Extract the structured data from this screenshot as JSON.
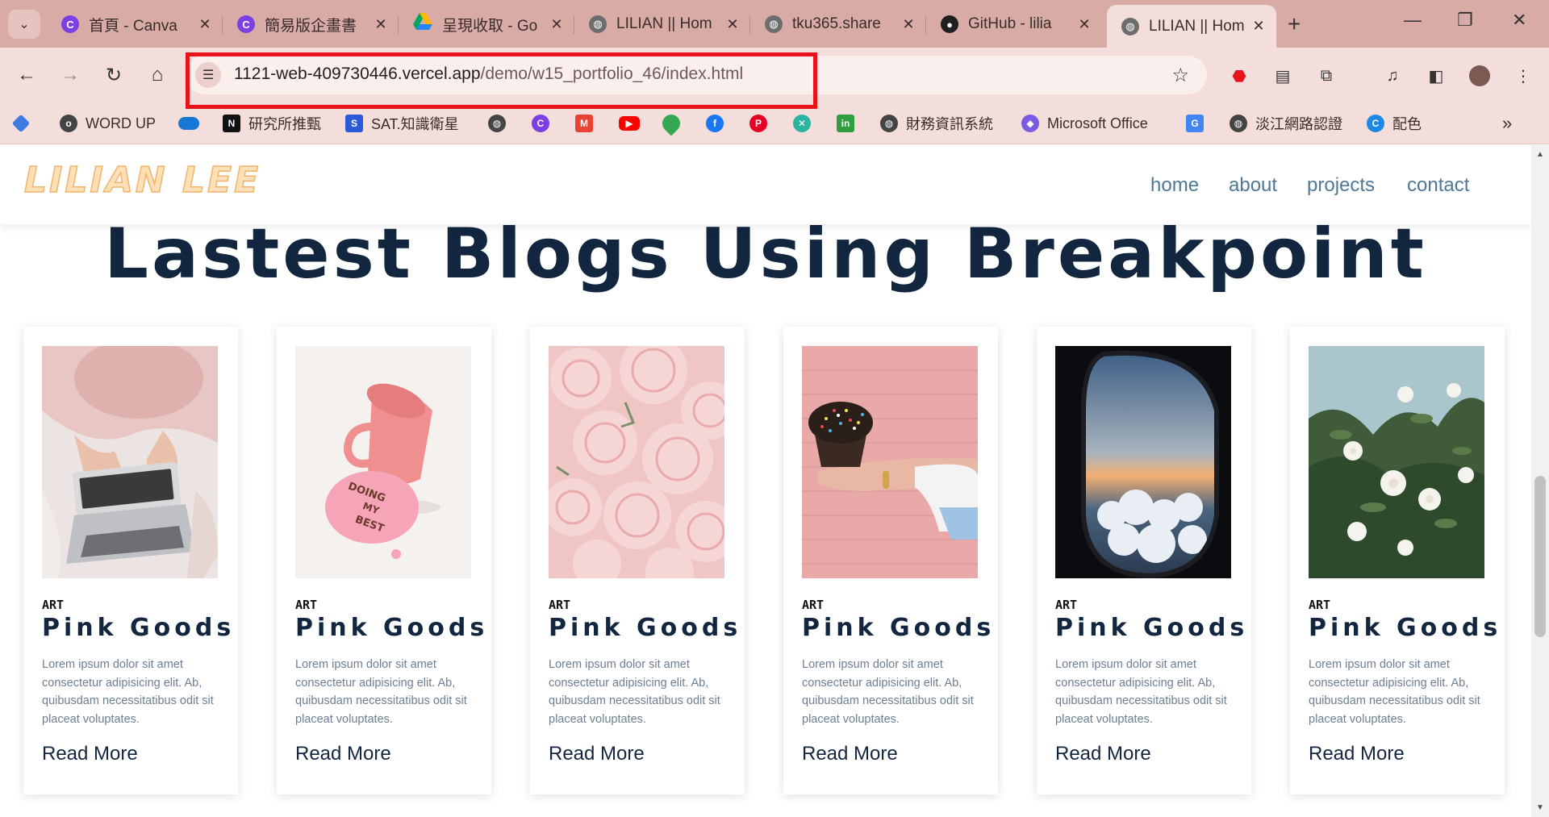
{
  "browser": {
    "tabs": [
      {
        "title": "首頁 - Canva",
        "icon": "canva-icon"
      },
      {
        "title": "簡易版企畫書",
        "icon": "canva-icon"
      },
      {
        "title": "呈現收取 - Go",
        "icon": "google-drive-icon"
      },
      {
        "title": "LILIAN || Hom",
        "icon": "globe-icon"
      },
      {
        "title": "tku365.share",
        "icon": "globe-icon"
      },
      {
        "title": "GitHub - lilia",
        "icon": "github-icon"
      },
      {
        "title": "LILIAN || Hom",
        "icon": "globe-icon",
        "active": true
      }
    ],
    "url_host": "1121-web-409730446.vercel.app",
    "url_path": "/demo/w15_portfolio_46/index.html",
    "bookmarks": [
      {
        "label": "",
        "icon": "bookmark-diamond-icon"
      },
      {
        "label": "WORD UP",
        "icon": "word-up-icon"
      },
      {
        "label": "",
        "icon": "onedrive-icon"
      },
      {
        "label": "研究所推甄",
        "icon": "notion-icon"
      },
      {
        "label": "SAT.知識衛星",
        "icon": "sat-icon"
      },
      {
        "label": "",
        "icon": "globe-icon"
      },
      {
        "label": "",
        "icon": "canva-icon"
      },
      {
        "label": "",
        "icon": "gmail-icon"
      },
      {
        "label": "",
        "icon": "youtube-icon"
      },
      {
        "label": "",
        "icon": "maps-icon"
      },
      {
        "label": "",
        "icon": "facebook-icon"
      },
      {
        "label": "",
        "icon": "pinterest-icon"
      },
      {
        "label": "",
        "icon": "tool-icon"
      },
      {
        "label": "",
        "icon": "in-icon"
      },
      {
        "label": "財務資訊系統",
        "icon": "globe-icon"
      },
      {
        "label": "Microsoft Office",
        "icon": "office-icon"
      },
      {
        "label": "",
        "icon": "translate-icon"
      },
      {
        "label": "淡江網路認證",
        "icon": "globe-icon"
      },
      {
        "label": "配色",
        "icon": "color-icon"
      }
    ]
  },
  "site": {
    "logo": "LILIAN LEE",
    "nav": [
      "home",
      "about",
      "projects",
      "contact"
    ],
    "section_title": "Lastest Blogs Using Breakpoint",
    "cards": [
      {
        "category": "ART",
        "title": "Pink Goods",
        "text": "Lorem ipsum dolor sit amet consectetur adipisicing elit. Ab, quibusdam necessitatibus odit sit placeat voluptates.",
        "link": "Read More",
        "image": "laptop-on-bed"
      },
      {
        "category": "ART",
        "title": "Pink Goods",
        "text": "Lorem ipsum dolor sit amet consectetur adipisicing elit. Ab, quibusdam necessitatibus odit sit placeat voluptates.",
        "link": "Read More",
        "image": "pink-cup-doing-my-best"
      },
      {
        "category": "ART",
        "title": "Pink Goods",
        "text": "Lorem ipsum dolor sit amet consectetur adipisicing elit. Ab, quibusdam necessitatibus odit sit placeat voluptates.",
        "link": "Read More",
        "image": "pink-carnations"
      },
      {
        "category": "ART",
        "title": "Pink Goods",
        "text": "Lorem ipsum dolor sit amet consectetur adipisicing elit. Ab, quibusdam necessitatibus odit sit placeat voluptates.",
        "link": "Read More",
        "image": "cupcake-in-hand"
      },
      {
        "category": "ART",
        "title": "Pink Goods",
        "text": "Lorem ipsum dolor sit amet consectetur adipisicing elit. Ab, quibusdam necessitatibus odit sit placeat voluptates.",
        "link": "Read More",
        "image": "airplane-window-clouds"
      },
      {
        "category": "ART",
        "title": "Pink Goods",
        "text": "Lorem ipsum dolor sit amet consectetur adipisicing elit. Ab, quibusdam necessitatibus odit sit placeat voluptates.",
        "link": "Read More",
        "image": "white-roses-sky"
      }
    ]
  },
  "colors": {
    "chrome_tabstrip": "#d8aba6",
    "chrome_toolbar": "#f3dedb",
    "highlight": "#e8131b",
    "heading": "#12263f",
    "nav": "#4f7896",
    "logo": "#f4b36b"
  }
}
